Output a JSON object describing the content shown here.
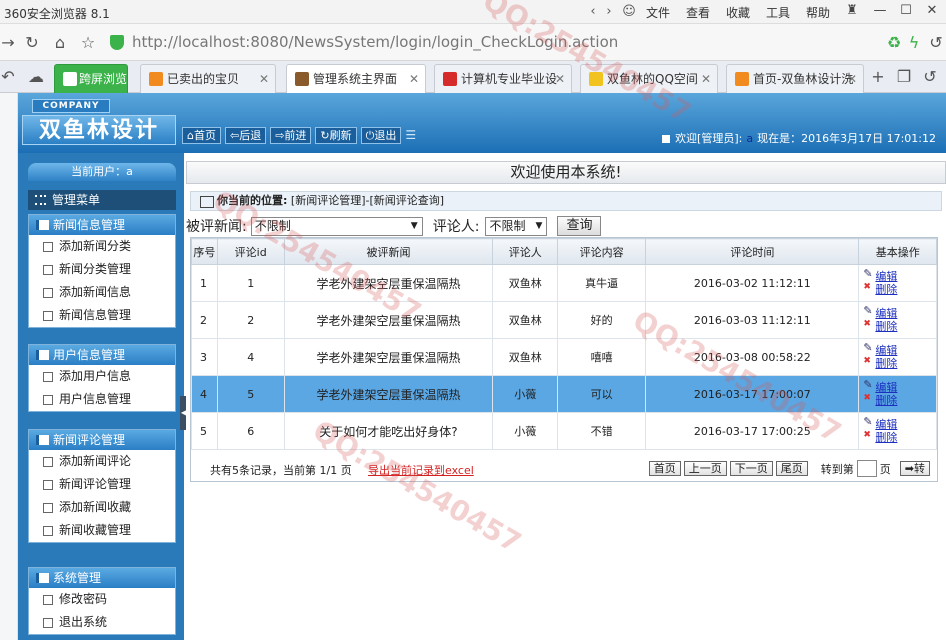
{
  "browser": {
    "app_title": "360安全浏览器 8.1",
    "menus": [
      "文件",
      "查看",
      "收藏",
      "工具",
      "帮助"
    ],
    "url_host": "http://localhost",
    "url_path": ":8080/NewsSystem/login/login_CheckLogin.action",
    "tabs": [
      {
        "label": "跨屏浏览",
        "color": "#3bb24a"
      },
      {
        "label": "已卖出的宝贝",
        "color": "#f28b1f"
      },
      {
        "label": "管理系统主界面",
        "color": "#8a5a2b"
      },
      {
        "label": "计算机专业毕业设",
        "color": "#d62b2b"
      },
      {
        "label": "双鱼林的QQ空间",
        "color": "#f2c21f"
      },
      {
        "label": "首页-双鱼林设计洗",
        "color": "#f28b1f"
      }
    ]
  },
  "header": {
    "company": "COMPANY",
    "logo": "双鱼林设计",
    "nav": [
      "首页",
      "后退",
      "前进",
      "刷新",
      "退出"
    ],
    "welcome": "欢迎[管理员]:",
    "user": "a",
    "time_label": "现在是：2016年3月17日 17:01:12"
  },
  "sidebar": {
    "current_user": "当前用户：a",
    "menu_title": "管理菜单",
    "groups": [
      {
        "title": "新闻信息管理",
        "items": [
          "添加新闻分类",
          "新闻分类管理",
          "添加新闻信息",
          "新闻信息管理"
        ]
      },
      {
        "title": "用户信息管理",
        "items": [
          "添加用户信息",
          "用户信息管理"
        ]
      },
      {
        "title": "新闻评论管理",
        "items": [
          "添加新闻评论",
          "新闻评论管理",
          "添加新闻收藏",
          "新闻收藏管理"
        ]
      },
      {
        "title": "系统管理",
        "items": [
          "修改密码",
          "退出系统"
        ]
      }
    ]
  },
  "main": {
    "welcome": "欢迎使用本系统!",
    "location_label": "你当前的位置:",
    "location_path": "[新闻评论管理]-[新闻评论查询]",
    "search": {
      "news_label": "被评新闻:",
      "news_value": "不限制",
      "user_label": "评论人:",
      "user_value": "不限制",
      "query_button": "查询"
    },
    "table": {
      "headers": [
        "序号",
        "评论id",
        "被评新闻",
        "评论人",
        "评论内容",
        "评论时间",
        "基本操作"
      ],
      "edit_label": "编辑",
      "delete_label": "删除",
      "rows": [
        [
          "1",
          "1",
          "学老外建架空层重保温隔热",
          "双鱼林",
          "真牛逼",
          "2016-03-02 11:12:11"
        ],
        [
          "2",
          "2",
          "学老外建架空层重保温隔热",
          "双鱼林",
          "好的",
          "2016-03-03 11:12:11"
        ],
        [
          "3",
          "4",
          "学老外建架空层重保温隔热",
          "双鱼林",
          "嘻嘻",
          "2016-03-08 00:58:22"
        ],
        [
          "4",
          "5",
          "学老外建架空层重保温隔热",
          "小薇",
          "可以",
          "2016-03-17 17:00:07"
        ],
        [
          "5",
          "6",
          "关于如何才能吃出好身体?",
          "小薇",
          "不错",
          "2016-03-17 17:00:25"
        ]
      ],
      "selected_row": 3
    },
    "pager": {
      "info": "共有5条记录，当前第 1/1 页",
      "export": "导出当前记录到excel",
      "first": "首页",
      "prev": "上一页",
      "next": "下一页",
      "last": "尾页",
      "goto": "转到第",
      "page_unit": "页",
      "go": "转"
    }
  }
}
